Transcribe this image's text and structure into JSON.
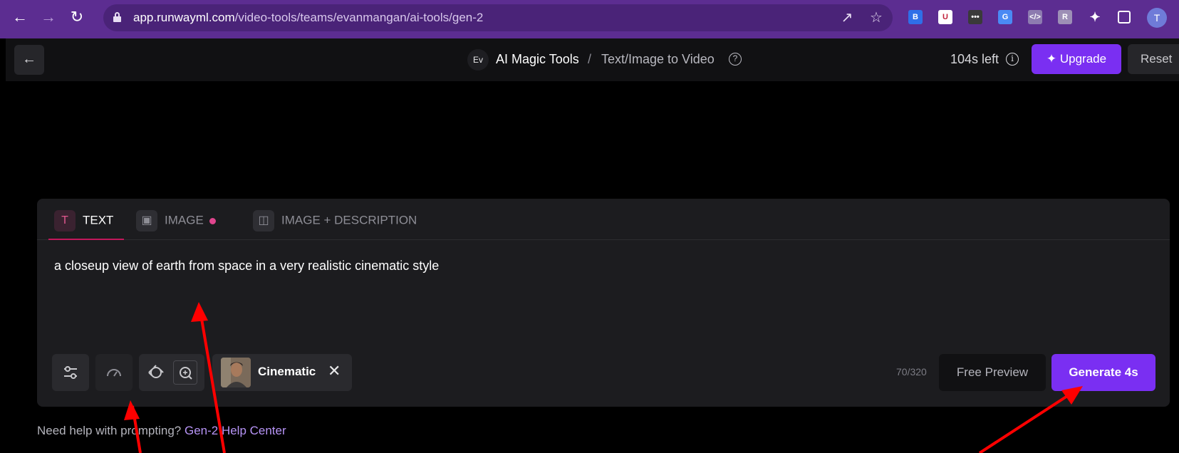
{
  "browser": {
    "url_domain": "app.runwayml.com",
    "url_path": "/video-tools/teams/evanmangan/ai-tools/gen-2",
    "profile_initial": "T",
    "accent_color": "#5c2d91"
  },
  "header": {
    "workspace_badge": "Ev",
    "section": "AI Magic Tools",
    "separator": "/",
    "current_page": "Text/Image to Video",
    "time_left": "104s left",
    "upgrade_label": "Upgrade",
    "reset_label": "Reset"
  },
  "tabs": [
    {
      "label": "TEXT",
      "active": true
    },
    {
      "label": "IMAGE",
      "active": false
    },
    {
      "label": "IMAGE + DESCRIPTION",
      "active": false
    }
  ],
  "prompt": {
    "value": "a closeup view of earth from space in a very realistic cinematic style"
  },
  "toolbar": {
    "style_label": "Cinematic",
    "char_count": "70/320",
    "free_preview_label": "Free Preview",
    "generate_label": "Generate 4s",
    "primary_color": "#7a2ff2"
  },
  "help": {
    "text": "Need help with prompting?",
    "link": "Gen-2 Help Center"
  }
}
